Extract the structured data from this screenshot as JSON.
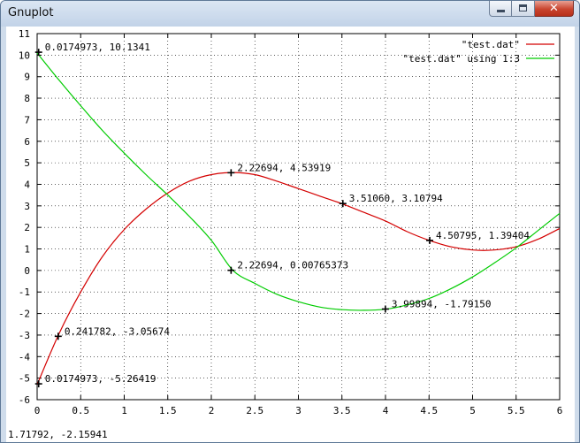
{
  "window": {
    "title": "Gnuplot",
    "minimize_icon": "minimize-icon",
    "maximize_icon": "maximize-icon",
    "close_icon": "close-icon",
    "close_glyph": "✕"
  },
  "status_text": "1.71792, -2.15941",
  "chart_data": {
    "type": "line",
    "xlim": [
      0,
      6
    ],
    "ylim": [
      -6,
      11
    ],
    "x_ticks": [
      0,
      0.5,
      1,
      1.5,
      2,
      2.5,
      3,
      3.5,
      4,
      4.5,
      5,
      5.5,
      6
    ],
    "x_tick_labels": [
      "0",
      "0.5",
      "1",
      "1.5",
      "2",
      "2.5",
      "3",
      "3.5",
      "4",
      "4.5",
      "5",
      "5.5",
      "6"
    ],
    "y_ticks": [
      -6,
      -5,
      -4,
      -3,
      -2,
      -1,
      0,
      1,
      2,
      3,
      4,
      5,
      6,
      7,
      8,
      9,
      10,
      11
    ],
    "y_tick_labels": [
      "-6",
      "-5",
      "-4",
      "-3",
      "-2",
      "-1",
      "0",
      "1",
      "2",
      "3",
      "4",
      "5",
      "6",
      "7",
      "8",
      "9",
      "10",
      "11"
    ],
    "grid": true,
    "legend_position": "top-right",
    "series": [
      {
        "name": "\"test.dat\"",
        "color": "#d40000",
        "x": [
          0,
          0.25,
          0.5,
          0.75,
          1,
          1.25,
          1.5,
          1.75,
          2,
          2.25,
          2.5,
          2.75,
          3,
          3.25,
          3.5,
          3.75,
          4,
          4.25,
          4.5,
          4.75,
          5,
          5.25,
          5.5,
          5.75,
          6
        ],
        "y": [
          -5.3,
          -2.95,
          -1.0,
          0.65,
          1.9,
          2.85,
          3.6,
          4.15,
          4.45,
          4.55,
          4.45,
          4.15,
          3.8,
          3.45,
          3.1,
          2.7,
          2.3,
          1.8,
          1.4,
          1.1,
          0.95,
          0.95,
          1.1,
          1.45,
          1.95
        ]
      },
      {
        "name": "\"test.dat\" using 1:3",
        "color": "#00cc00",
        "x": [
          0,
          0.25,
          0.5,
          0.75,
          1,
          1.25,
          1.5,
          1.75,
          2,
          2.25,
          2.5,
          2.75,
          3,
          3.25,
          3.5,
          3.75,
          4,
          4.25,
          4.5,
          4.75,
          5,
          5.25,
          5.5,
          5.75,
          6
        ],
        "y": [
          10.1,
          8.85,
          7.65,
          6.5,
          5.45,
          4.45,
          3.5,
          2.5,
          1.4,
          0.0,
          -0.6,
          -1.1,
          -1.45,
          -1.7,
          -1.82,
          -1.85,
          -1.8,
          -1.6,
          -1.3,
          -0.85,
          -0.3,
          0.35,
          1.05,
          1.85,
          2.65
        ]
      }
    ],
    "annotations": [
      {
        "x": 0.0174973,
        "y": 10.1341,
        "label": "0.0174973,  10.1341"
      },
      {
        "x": 2.22694,
        "y": 4.53919,
        "label": "2.22694,  4.53919"
      },
      {
        "x": 3.5106,
        "y": 3.10794,
        "label": "3.51060,  3.10794"
      },
      {
        "x": 4.50795,
        "y": 1.39404,
        "label": "4.50795,  1.39404"
      },
      {
        "x": 2.22694,
        "y": 0.00765373,
        "label": "2.22694,  0.00765373"
      },
      {
        "x": 3.99894,
        "y": -1.7915,
        "label": "3.99894, -1.79150"
      },
      {
        "x": 0.241782,
        "y": -3.05674,
        "label": "0.241782, -3.05674"
      },
      {
        "x": 0.0174973,
        "y": -5.26419,
        "label": "0.0174973, -5.26419"
      }
    ]
  }
}
